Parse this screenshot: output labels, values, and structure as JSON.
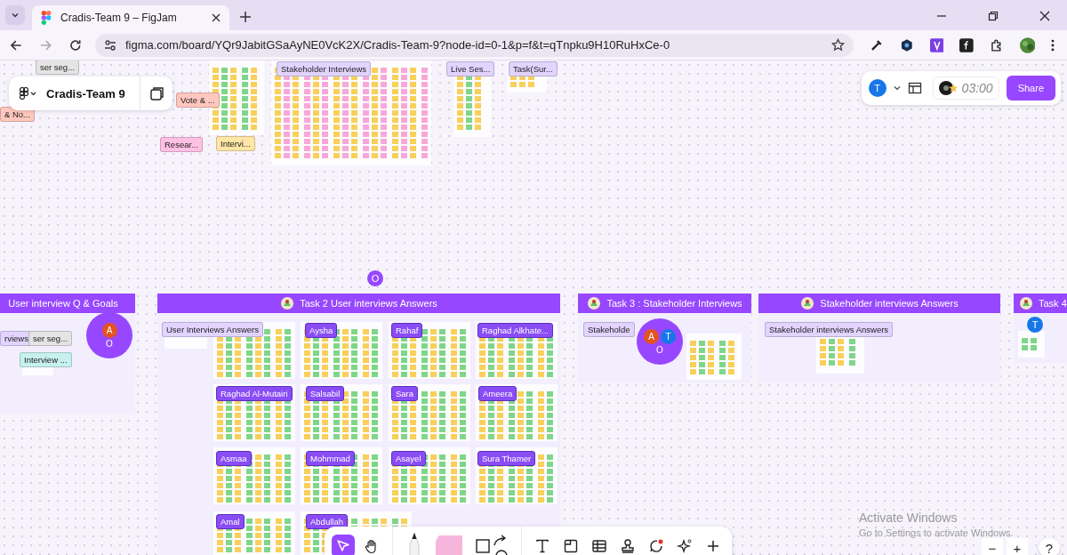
{
  "browser": {
    "tab_title": "Cradis-Team 9 – FigJam",
    "url": "figma.com/board/YQr9JabitGSaAyNE0VcK2X/Cradis-Team-9?node-id=0-1&p=f&t=qTnpku9H10RuHxCe-0"
  },
  "file_panel": {
    "name": "Cradis-Team 9"
  },
  "top_toolbar": {
    "user_initial": "T",
    "timer": "03:00",
    "share": "Share"
  },
  "sections": [
    {
      "title": "User interview Q & Goals",
      "kind": "plain"
    },
    {
      "title": "Task 2  User interviews Answers",
      "kind": "with-icon"
    },
    {
      "title": "Task 3 : Stakeholder Interviews",
      "kind": "with-icon"
    },
    {
      "title": "Stakeholder interviews Answers",
      "kind": "with-icon"
    },
    {
      "title": "Task 4",
      "kind": "with-icon"
    }
  ],
  "labels": [
    {
      "text": "ser seg...",
      "kind": "label",
      "color": "#e4e4e4"
    },
    {
      "text": "& No...",
      "kind": "label",
      "color": "#ffc7bd"
    },
    {
      "text": "Vote & ...",
      "kind": "label",
      "color": "#ffc7bd"
    },
    {
      "text": "Resear...",
      "kind": "label",
      "color": "#ffc1e3"
    },
    {
      "text": "Intervi...",
      "kind": "label",
      "color": "#ffe6a6"
    },
    {
      "text": "Stakeholder Interviews",
      "kind": "label",
      "color": "#e2d4ff"
    },
    {
      "text": "Live Ses...",
      "kind": "label",
      "color": "#e2d4ff"
    },
    {
      "text": "Task(Sur...",
      "kind": "label",
      "color": "#e2d4ff"
    },
    {
      "text": "rviews",
      "kind": "label",
      "color": "#e2d4ff"
    },
    {
      "text": "ser seg...",
      "kind": "label",
      "color": "#e4e4e4"
    },
    {
      "text": "Interview ...",
      "kind": "label",
      "color": "#c7f1ee"
    },
    {
      "text": "User Interviews Answers",
      "kind": "label",
      "color": "#e2d4ff"
    },
    {
      "text": "Aysha",
      "kind": "tag",
      "color": "#8a4cf5"
    },
    {
      "text": "Rahaf",
      "kind": "tag",
      "color": "#8a4cf5"
    },
    {
      "text": "Raghad Alkhate...",
      "kind": "tag",
      "color": "#8a4cf5"
    },
    {
      "text": "Raghad Al-Mutairi",
      "kind": "tag",
      "color": "#8a4cf5"
    },
    {
      "text": "Salsabil",
      "kind": "tag",
      "color": "#8a4cf5"
    },
    {
      "text": "Sara",
      "kind": "tag",
      "color": "#8a4cf5"
    },
    {
      "text": "Ameera",
      "kind": "tag",
      "color": "#8a4cf5"
    },
    {
      "text": "Asmaa",
      "kind": "tag",
      "color": "#8a4cf5"
    },
    {
      "text": "Mohmmad",
      "kind": "tag",
      "color": "#8a4cf5"
    },
    {
      "text": "Asayel",
      "kind": "tag",
      "color": "#8a4cf5"
    },
    {
      "text": "Sura Thamer",
      "kind": "tag",
      "color": "#8a4cf5"
    },
    {
      "text": "Amal",
      "kind": "tag",
      "color": "#8a4cf5"
    },
    {
      "text": "Abdullah",
      "kind": "tag",
      "color": "#8a4cf5"
    },
    {
      "text": "Stakeholde",
      "kind": "label",
      "color": "#e2d4ff"
    },
    {
      "text": "Stakeholder interviews Answers",
      "kind": "label",
      "color": "#e2d4ff"
    }
  ],
  "cursors": [
    {
      "kind": "single",
      "initial": "O",
      "color": "#9747ff"
    },
    {
      "kind": "group",
      "initial": "O",
      "avatars": [
        {
          "initial": "A",
          "color": "#e5531f"
        }
      ]
    },
    {
      "kind": "group",
      "initial": "O",
      "avatars": [
        {
          "initial": "A",
          "color": "#e5531f"
        },
        {
          "initial": "T",
          "color": "#1877e8"
        }
      ]
    },
    {
      "kind": "single",
      "initial": "T",
      "color": "#1877e8"
    }
  ],
  "tools": [
    {
      "kind": "move",
      "selected": true
    },
    {
      "kind": "hand",
      "selected": false
    },
    {
      "kind": "pen",
      "selected": false
    },
    {
      "kind": "sticky",
      "selected": false
    },
    {
      "kind": "shape",
      "selected": false
    },
    {
      "kind": "text",
      "selected": false
    },
    {
      "kind": "section",
      "selected": false
    },
    {
      "kind": "table",
      "selected": false
    },
    {
      "kind": "stamp",
      "selected": false
    },
    {
      "kind": "comment",
      "selected": false
    },
    {
      "kind": "ai",
      "selected": false
    },
    {
      "kind": "more",
      "selected": false
    }
  ],
  "zoom": {
    "out": "−",
    "in": "+",
    "help": "?"
  },
  "os_notice": {
    "title": "Activate Windows",
    "body": "Go to Settings to activate Windows."
  }
}
